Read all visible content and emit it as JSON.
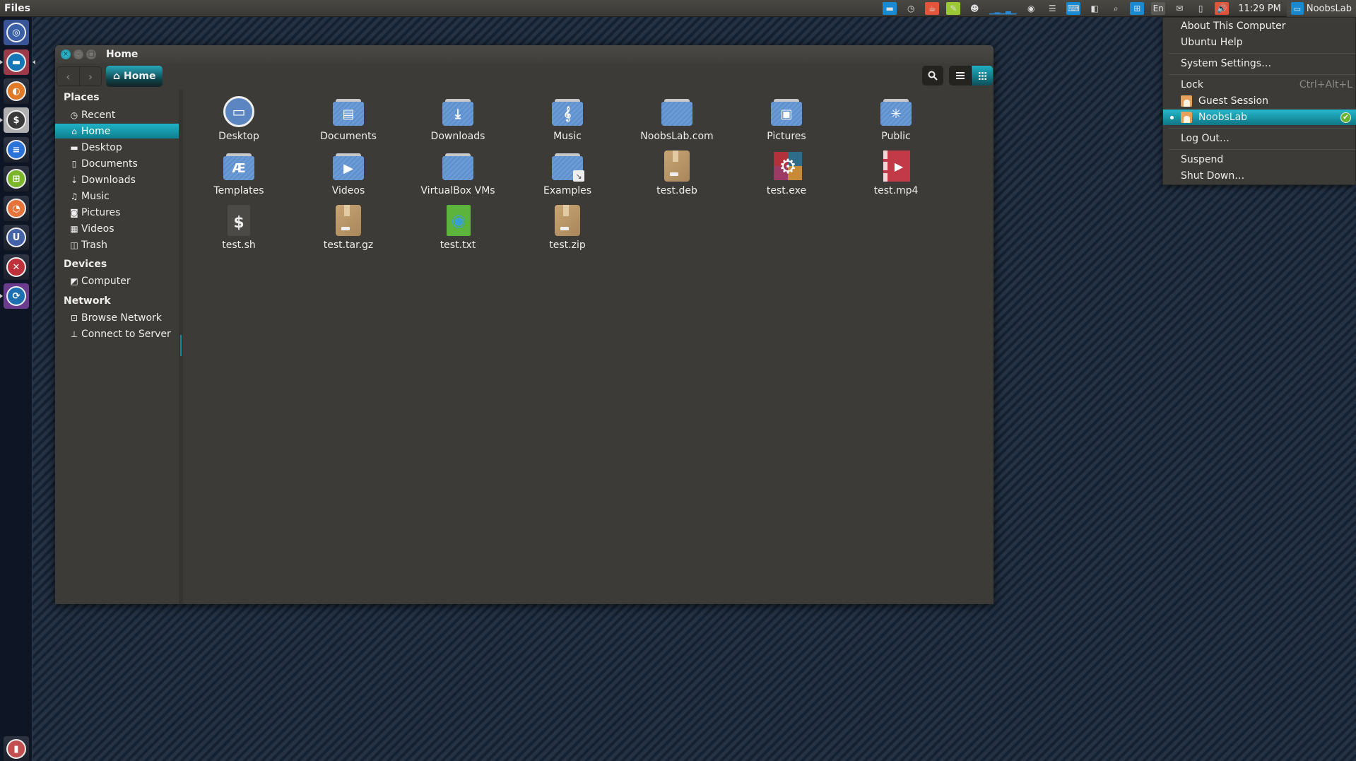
{
  "top_panel": {
    "app_name": "Files",
    "indicators": [
      {
        "name": "files-indicator-icon",
        "glyph": "▬",
        "bg": "#1a8ad0"
      },
      {
        "name": "clock-indicator-icon",
        "glyph": "◷",
        "bg": ""
      },
      {
        "name": "caffeine-indicator-icon",
        "glyph": "☕",
        "bg": "#e2553b"
      },
      {
        "name": "notes-indicator-icon",
        "glyph": "✎",
        "bg": "#9ac934"
      },
      {
        "name": "pidgin-indicator-icon",
        "glyph": "☻",
        "bg": ""
      },
      {
        "name": "system-monitor-graph-icon",
        "glyph": "▁▂▁▃▁",
        "bg": ""
      },
      {
        "name": "eye-indicator-icon",
        "glyph": "◉",
        "bg": ""
      },
      {
        "name": "menu-list-indicator-icon",
        "glyph": "☰",
        "bg": ""
      },
      {
        "name": "keyboard-indicator-icon",
        "glyph": "⌨",
        "bg": "#1a8ad0"
      },
      {
        "name": "disk-indicator-icon",
        "glyph": "◧",
        "bg": ""
      },
      {
        "name": "search-indicator-icon",
        "glyph": "⌕",
        "bg": ""
      },
      {
        "name": "network-indicator-icon",
        "glyph": "⊞",
        "bg": "#1a8ad0"
      },
      {
        "name": "language-indicator-icon",
        "glyph": "En",
        "bg": "#5a5955"
      },
      {
        "name": "mail-indicator-icon",
        "glyph": "✉",
        "bg": ""
      },
      {
        "name": "battery-indicator-icon",
        "glyph": "▯",
        "bg": ""
      },
      {
        "name": "sound-indicator-icon",
        "glyph": "🔊",
        "bg": "#e2553b"
      }
    ],
    "clock": "11:29 PM",
    "user_name": "NoobsLab"
  },
  "launcher": {
    "items": [
      {
        "name": "dash-home-icon",
        "glyph": "◎",
        "color": "#3a60a8",
        "bg": "#3a5597"
      },
      {
        "name": "files-app-icon",
        "glyph": "▬",
        "color": "#1677b6",
        "bg": "#9c3a4a"
      },
      {
        "name": "firefox-app-icon",
        "glyph": "◐",
        "color": "#e07a27",
        "bg": ""
      },
      {
        "name": "terminal-app-icon",
        "glyph": "$",
        "color": "#3a3a3a",
        "bg": "#b0b0b0"
      },
      {
        "name": "writer-app-icon",
        "glyph": "≡",
        "color": "#2a73d9",
        "bg": ""
      },
      {
        "name": "calc-app-icon",
        "glyph": "⊞",
        "color": "#7ab52a",
        "bg": ""
      },
      {
        "name": "impress-app-icon",
        "glyph": "◔",
        "color": "#e6733a",
        "bg": ""
      },
      {
        "name": "software-center-icon",
        "glyph": "U",
        "color": "#4563a8",
        "bg": ""
      },
      {
        "name": "system-settings-icon",
        "glyph": "✕",
        "color": "#c0303b",
        "bg": ""
      },
      {
        "name": "update-manager-icon",
        "glyph": "⟳",
        "color": "#1c6fb0",
        "bg": "#6b3b8e"
      }
    ],
    "trash": {
      "name": "trash-launcher-icon",
      "glyph": "▮",
      "color": "#c35050"
    }
  },
  "window": {
    "title": "Home",
    "path_button": "Home",
    "sidebar": {
      "places_heading": "Places",
      "places": [
        {
          "label": "Recent",
          "icon": "clock-icon",
          "glyph": "◷"
        },
        {
          "label": "Home",
          "icon": "home-icon",
          "glyph": "⌂",
          "active": true
        },
        {
          "label": "Desktop",
          "icon": "folder-icon",
          "glyph": "▬"
        },
        {
          "label": "Documents",
          "icon": "document-icon",
          "glyph": "▯"
        },
        {
          "label": "Downloads",
          "icon": "download-icon",
          "glyph": "⇣"
        },
        {
          "label": "Music",
          "icon": "music-icon",
          "glyph": "♫"
        },
        {
          "label": "Pictures",
          "icon": "camera-icon",
          "glyph": "◙"
        },
        {
          "label": "Videos",
          "icon": "film-icon",
          "glyph": "▦"
        },
        {
          "label": "Trash",
          "icon": "trash-icon",
          "glyph": "◫"
        }
      ],
      "devices_heading": "Devices",
      "devices": [
        {
          "label": "Computer",
          "icon": "harddisk-icon",
          "glyph": "◩"
        }
      ],
      "network_heading": "Network",
      "network": [
        {
          "label": "Browse Network",
          "icon": "network-icon",
          "glyph": "⊡"
        },
        {
          "label": "Connect to Server",
          "icon": "server-icon",
          "glyph": "⊥"
        }
      ]
    },
    "files": [
      {
        "label": "Desktop",
        "type": "desktop",
        "glyph": "▭"
      },
      {
        "label": "Documents",
        "type": "folder",
        "glyph": "▤"
      },
      {
        "label": "Downloads",
        "type": "folder",
        "glyph": "⤓"
      },
      {
        "label": "Music",
        "type": "folder",
        "glyph": "𝄞"
      },
      {
        "label": "NoobsLab.com",
        "type": "folder",
        "glyph": ""
      },
      {
        "label": "Pictures",
        "type": "folder",
        "glyph": "▣"
      },
      {
        "label": "Public",
        "type": "folder",
        "glyph": "✳"
      },
      {
        "label": "Templates",
        "type": "folder",
        "glyph": "Æ"
      },
      {
        "label": "Videos",
        "type": "folder",
        "glyph": "▶"
      },
      {
        "label": "VirtualBox VMs",
        "type": "folder",
        "glyph": ""
      },
      {
        "label": "Examples",
        "type": "folder-link",
        "glyph": ""
      },
      {
        "label": "test.deb",
        "type": "package",
        "glyph": ""
      },
      {
        "label": "test.exe",
        "type": "exe",
        "glyph": "⚙"
      },
      {
        "label": "test.mp4",
        "type": "video",
        "glyph": "▶"
      },
      {
        "label": "test.sh",
        "type": "script",
        "glyph": "$"
      },
      {
        "label": "test.tar.gz",
        "type": "package",
        "glyph": ""
      },
      {
        "label": "test.txt",
        "type": "text",
        "glyph": "◉"
      },
      {
        "label": "test.zip",
        "type": "zip",
        "glyph": ""
      }
    ]
  },
  "user_menu": {
    "items": [
      {
        "label": "About This Computer"
      },
      {
        "label": "Ubuntu Help"
      },
      {
        "separator": true
      },
      {
        "label": "System Settings…"
      },
      {
        "separator": true
      },
      {
        "label": "Lock",
        "accel": "Ctrl+Alt+L"
      },
      {
        "label": "Guest Session",
        "user_icon": true
      },
      {
        "label": "NoobsLab",
        "user_icon": true,
        "active": true,
        "current": true
      },
      {
        "separator": true
      },
      {
        "label": "Log Out…"
      },
      {
        "separator": true
      },
      {
        "label": "Suspend"
      },
      {
        "label": "Shut Down…"
      }
    ]
  },
  "colors": {
    "accent": "#1fb0c4",
    "window_bg": "#3c3b37",
    "launcher_bg": "#0e1626"
  }
}
